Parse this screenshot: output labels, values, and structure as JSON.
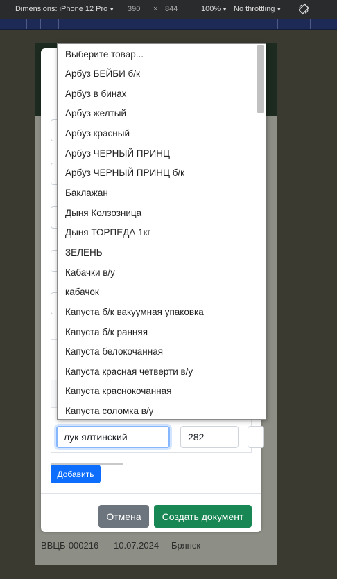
{
  "devtools": {
    "dimensions_label": "Dimensions: iPhone 12 Pro",
    "width": "390",
    "times": "×",
    "height": "844",
    "zoom": "100%",
    "throttling": "No throttling",
    "rotate_icon": "rotate-device-icon"
  },
  "dropdown": {
    "options": [
      "Выберите товар...",
      "Арбуз БЕЙБИ б/к",
      "Арбуз в бинах",
      "Арбуз желтый",
      "Арбуз красный",
      "Арбуз ЧЕРНЫЙ ПРИНЦ",
      "Арбуз ЧЕРНЫЙ ПРИНЦ б/к",
      "Баклажан",
      "Дыня Колзозница",
      "Дыня ТОРПЕДА 1кг",
      "ЗЕЛЕНЬ",
      "Кабачки в/у",
      "кабачок",
      "Капуста б/к вакуумная упаковка",
      "Капуста б/к ранняя",
      "Капуста белокочанная",
      "Капуста красная четверти в/у",
      "Капуста краснокочанная",
      "Капуста соломка в/у"
    ]
  },
  "modal": {
    "row": {
      "product_value": "лук ялтинский",
      "quantity_value": "282"
    },
    "add_button": "Добавить",
    "cancel_button": "Отмена",
    "create_button": "Создать документ"
  },
  "background_row": {
    "code": "ВВЦБ-000216",
    "date": "10.07.2024",
    "city": "Брянск"
  },
  "colors": {
    "primary": "#0d6efd",
    "secondary": "#6c757d",
    "success": "#198754"
  }
}
